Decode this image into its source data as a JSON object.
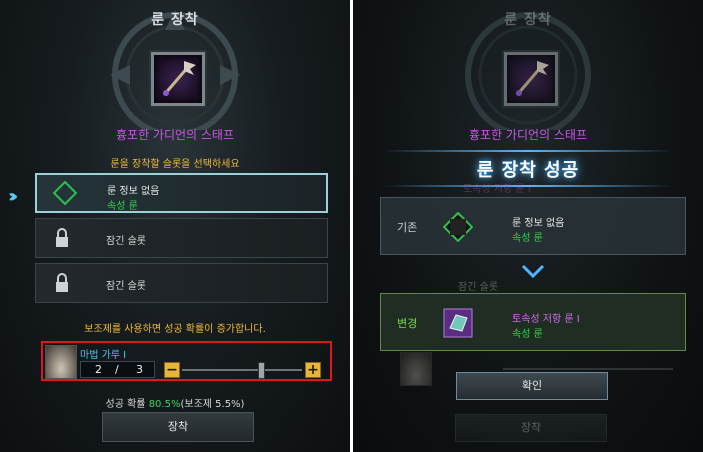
{
  "left": {
    "title": "룬 장착",
    "item_name": "흉포한 가디언의 스태프",
    "instruction": "룬을 장착할 슬롯을 선택하세요",
    "slots": [
      {
        "line1": "룬 정보 없음",
        "line2": "속성 룬"
      },
      {
        "line1": "잠긴 슬롯"
      },
      {
        "line1": "잠긴 슬롯"
      }
    ],
    "booster_notice": "보조제를 사용하면 성공 확률이 증가합니다.",
    "material": {
      "name": "마법 가루 I",
      "count_current": "2",
      "count_sep": "/",
      "count_max": "3",
      "minus": "−",
      "plus": "+"
    },
    "success_rate": {
      "label": "성공 확률 ",
      "value": "80.5%",
      "suffix": "(보조제 5.5%)"
    },
    "equip_button": "장착"
  },
  "right": {
    "title": "룬 장착",
    "item_name": "흉포한 가디언의 스태프",
    "success_title": "룬 장착 성공",
    "before": {
      "label": "기존",
      "line1": "룬 정보 없음",
      "line2": "속성 룬"
    },
    "after": {
      "label": "변경",
      "line1": "토속성 저항 룬 I",
      "line2": "속성 룬"
    },
    "bg_slot_1": "토속성 저항 룬 I",
    "bg_slot_2": "잠긴 슬롯",
    "bg_equip": "장착",
    "confirm_button": "확인"
  },
  "colors": {
    "accent_blue": "#58c8f0",
    "highlight_red": "#e0161a",
    "green": "#3bd24a",
    "purple": "#c955e8",
    "gold": "#f0b93a"
  }
}
